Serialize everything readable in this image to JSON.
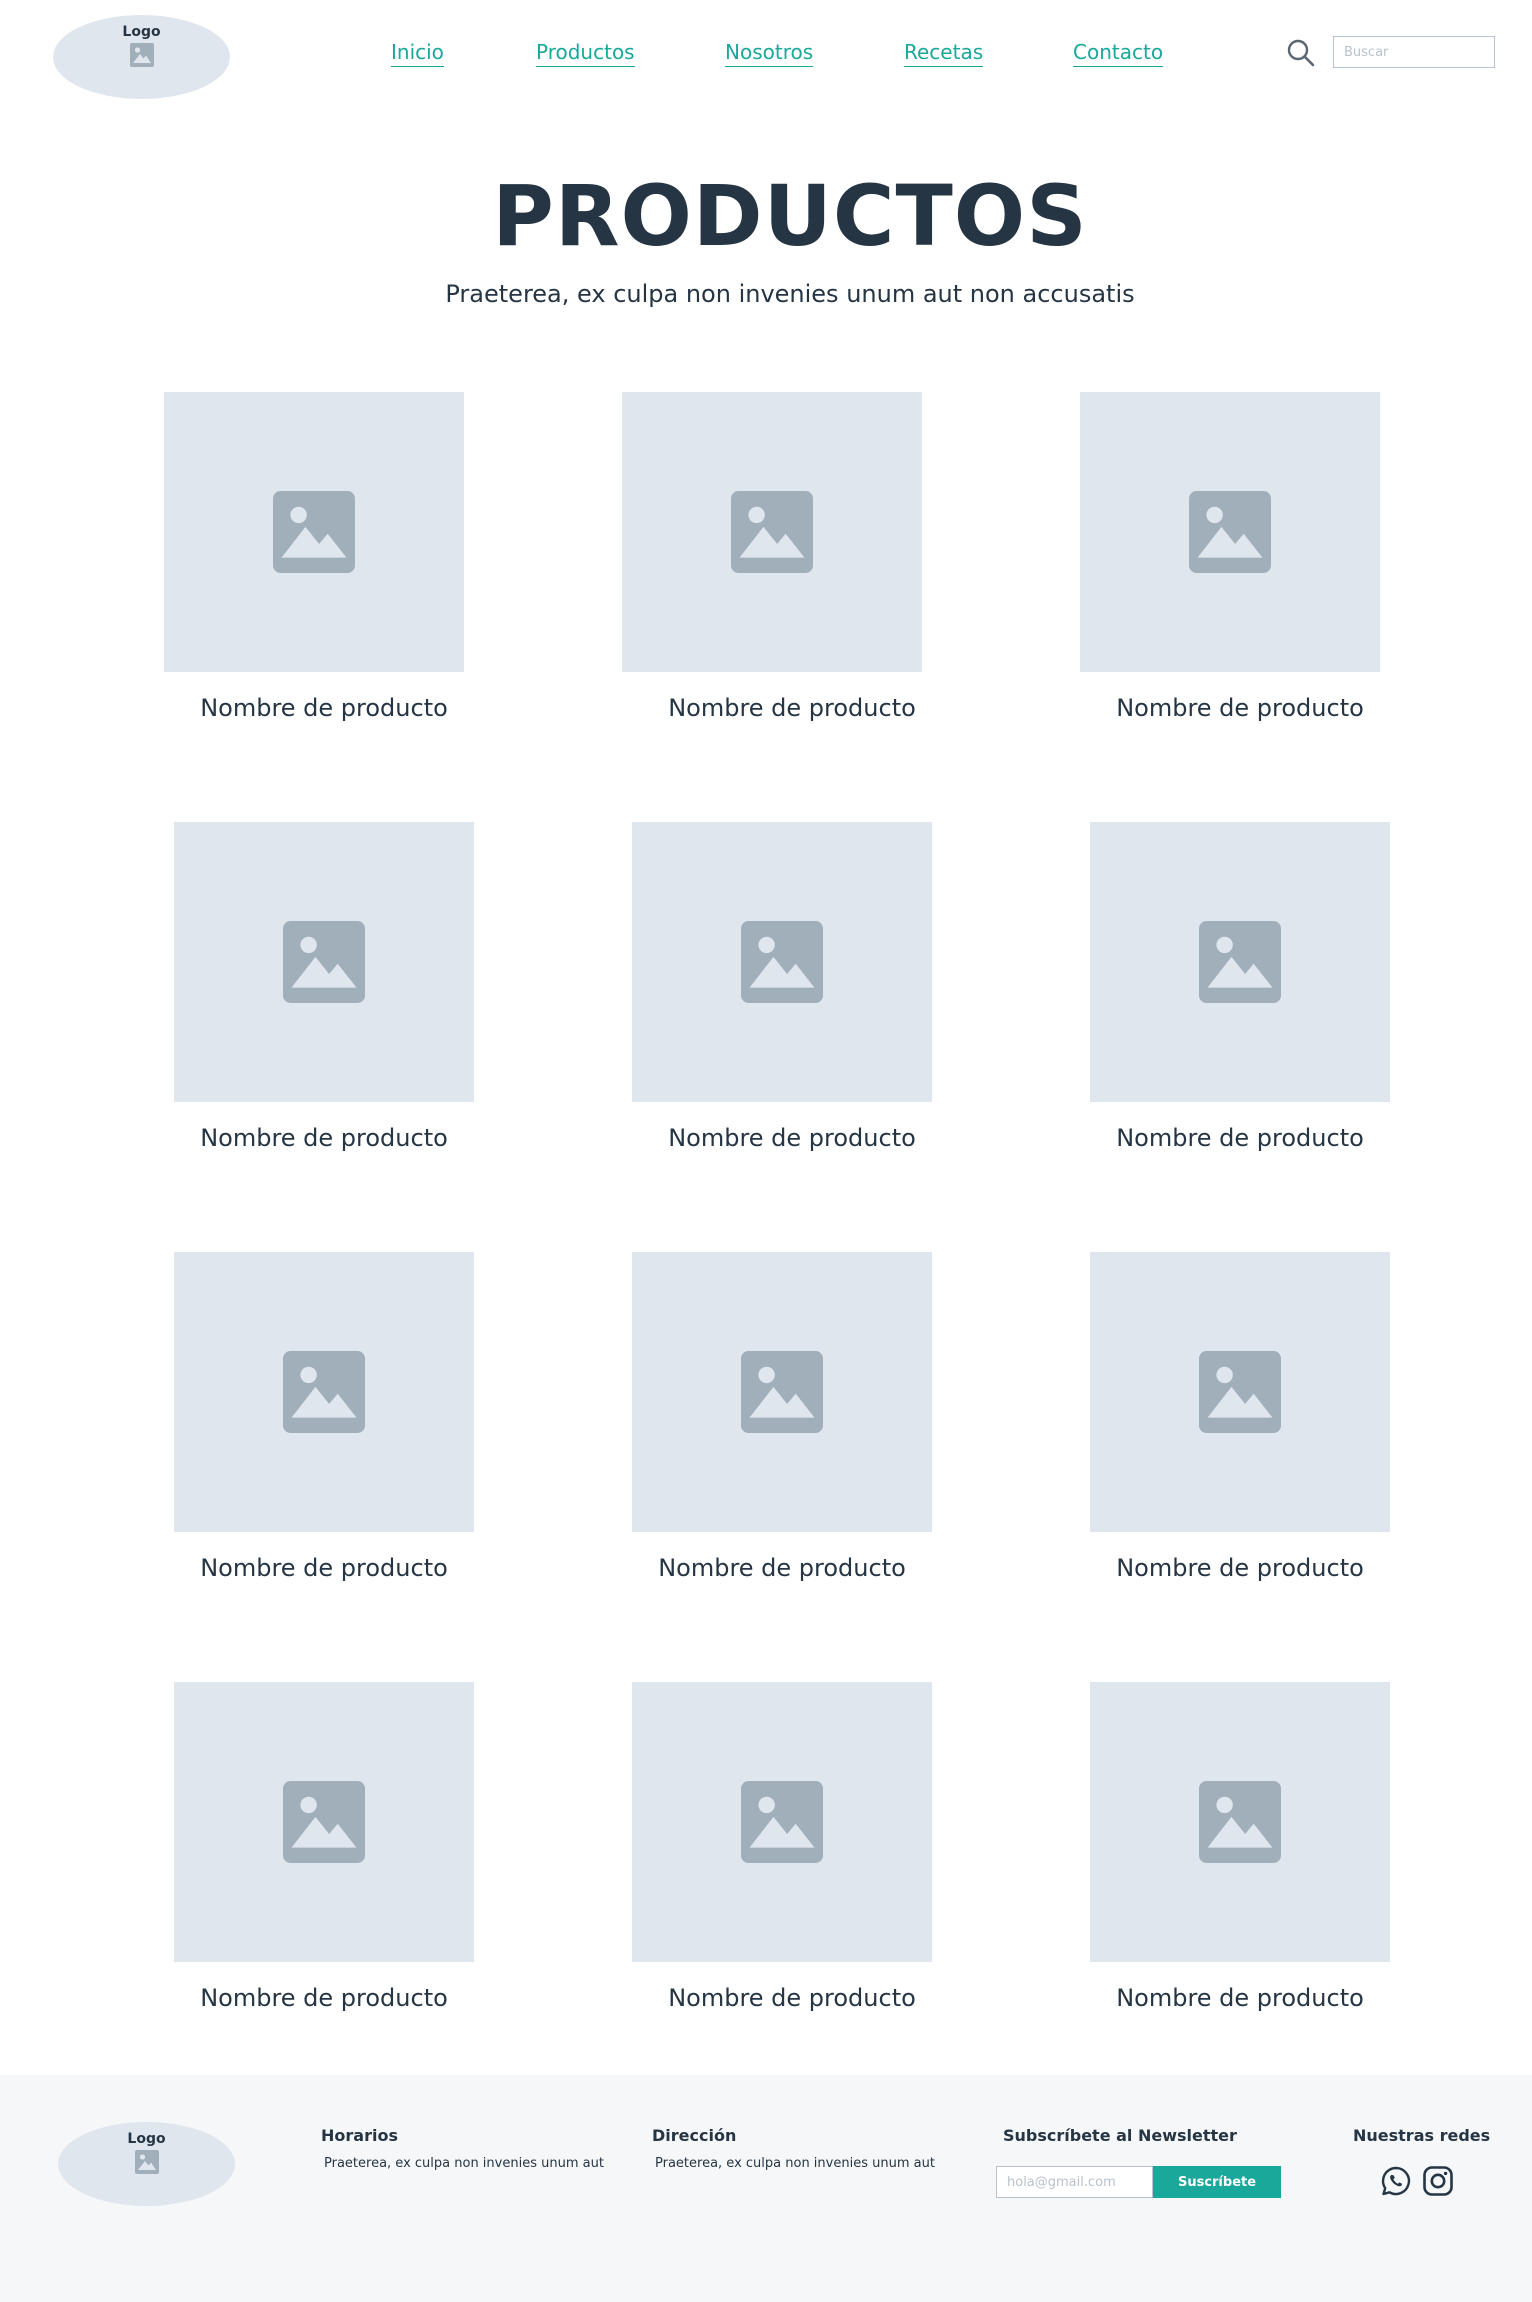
{
  "header": {
    "logo_label": "Logo",
    "nav": [
      {
        "label": "Inicio"
      },
      {
        "label": "Productos"
      },
      {
        "label": "Nosotros"
      },
      {
        "label": "Recetas"
      },
      {
        "label": "Contacto"
      }
    ],
    "search_placeholder": "Buscar"
  },
  "hero": {
    "title": "PRODUCTOS",
    "subtitle": "Praeterea, ex culpa non invenies unum aut non accusatis"
  },
  "products": [
    {
      "name": "Nombre de producto"
    },
    {
      "name": "Nombre de producto"
    },
    {
      "name": "Nombre de producto"
    },
    {
      "name": "Nombre de producto"
    },
    {
      "name": "Nombre de producto"
    },
    {
      "name": "Nombre de producto"
    },
    {
      "name": "Nombre de producto"
    },
    {
      "name": "Nombre de producto"
    },
    {
      "name": "Nombre de producto"
    },
    {
      "name": "Nombre de producto"
    },
    {
      "name": "Nombre de producto"
    },
    {
      "name": "Nombre de producto"
    }
  ],
  "footer": {
    "logo_label": "Logo",
    "hours_heading": "Horarios",
    "hours_text": "Praeterea, ex culpa non invenies unum aut",
    "address_heading": "Dirección",
    "address_text": "Praeterea, ex culpa non invenies unum aut",
    "newsletter_heading": "Subscríbete al Newsletter",
    "newsletter_placeholder": "hola@gmail.com",
    "newsletter_button": "Suscríbete",
    "social_heading": "Nuestras redes",
    "social_icons": [
      "whatsapp-icon",
      "instagram-icon"
    ]
  },
  "colors": {
    "accent": "#1aa89a",
    "text": "#263544",
    "placeholder_bg": "#e0e6ee",
    "placeholder_icon": "#a1afbb",
    "footer_bg": "#f6f7f9"
  }
}
